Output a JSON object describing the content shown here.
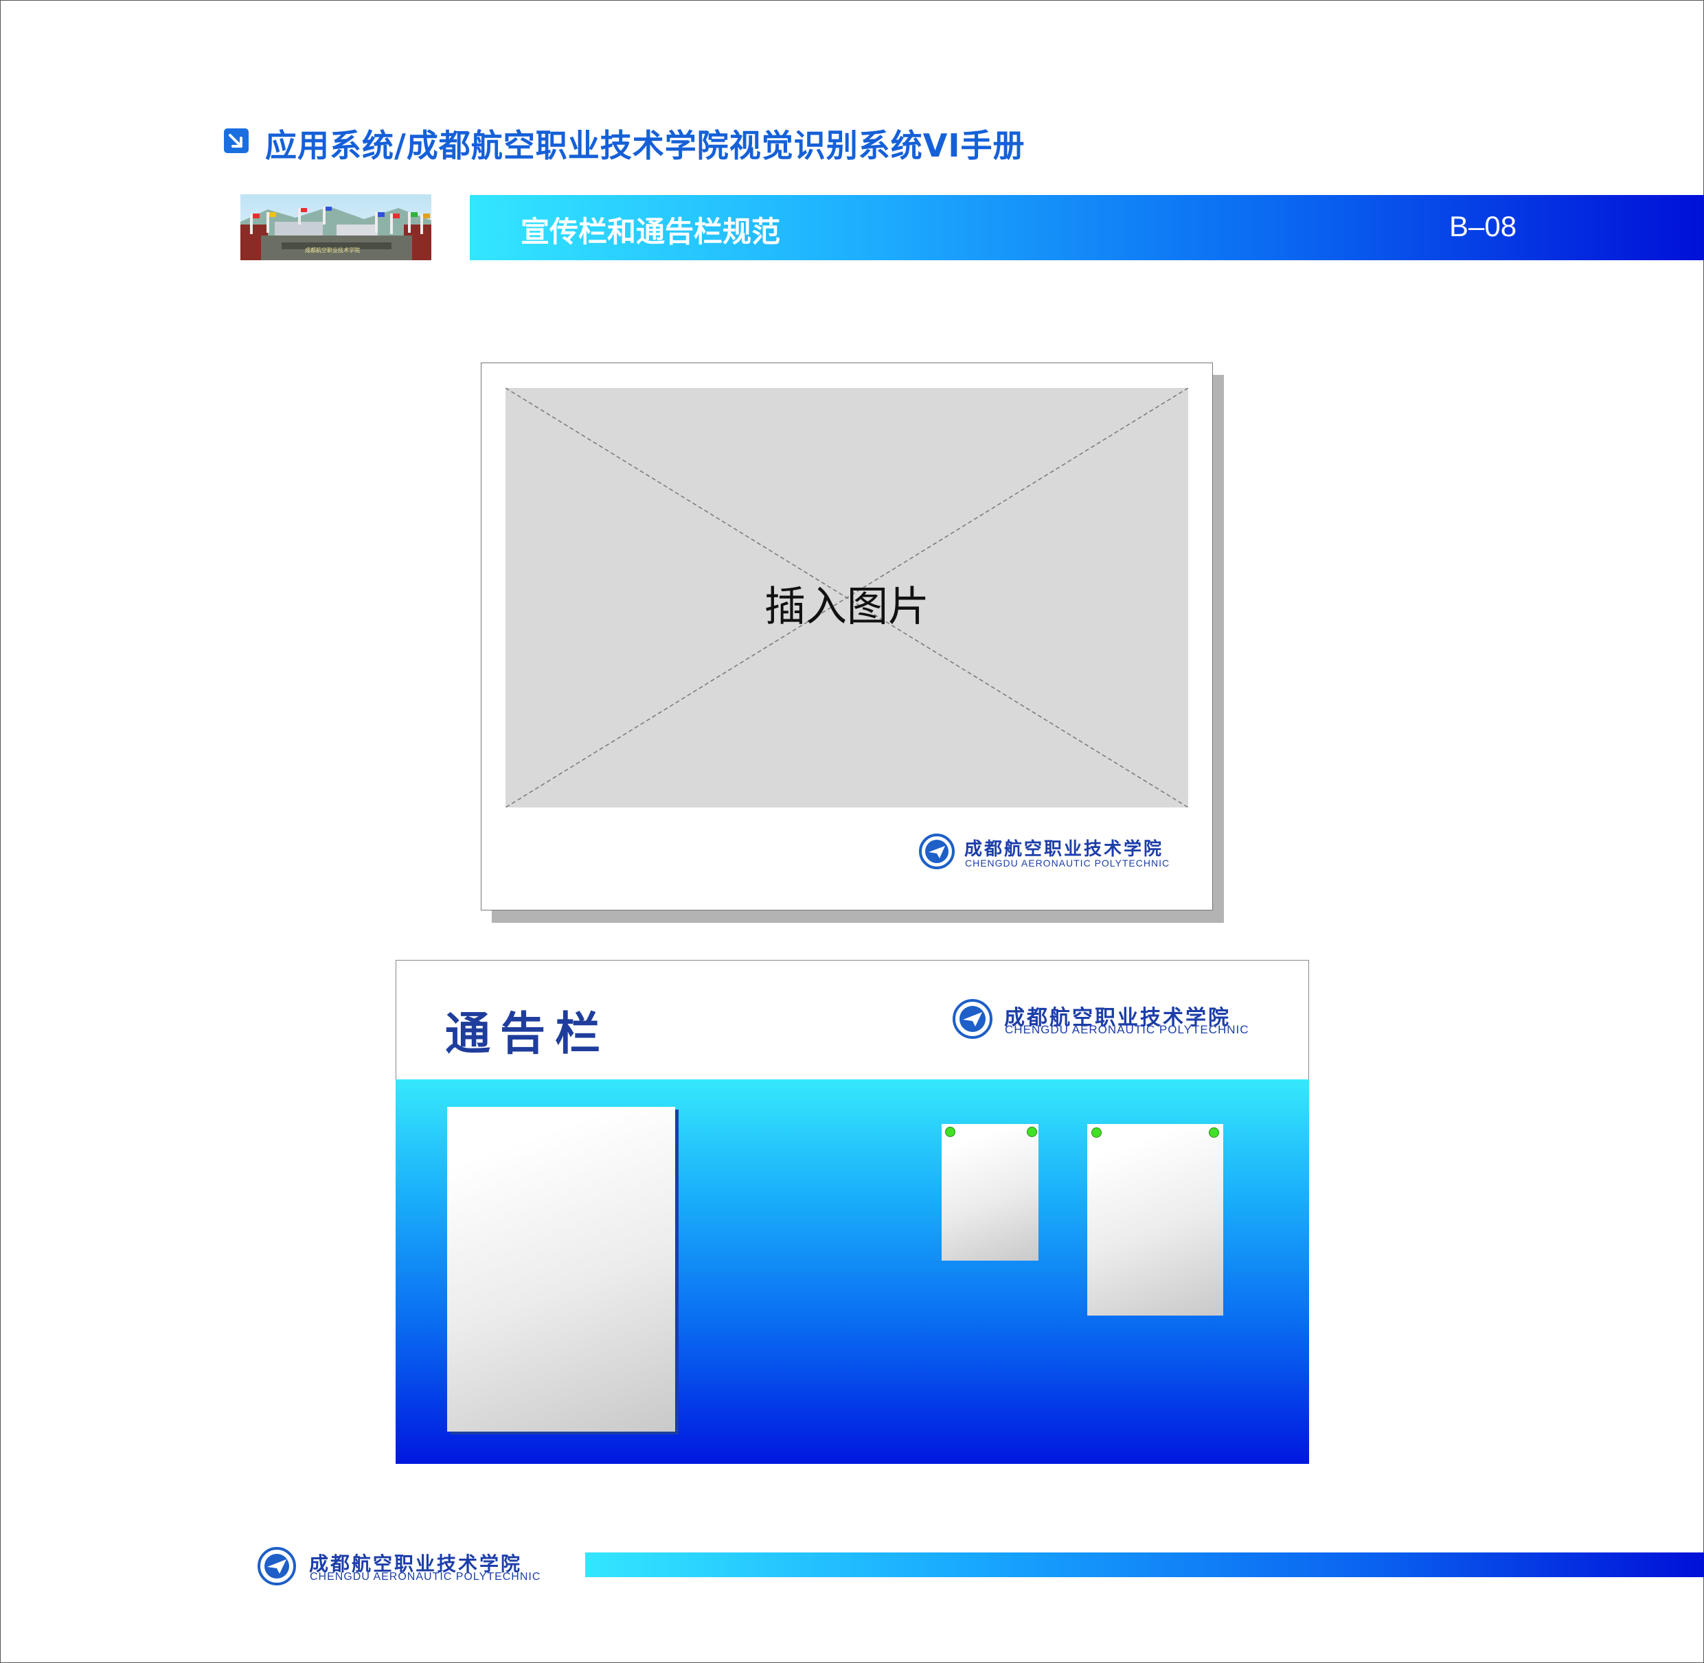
{
  "header": {
    "title": "应用系统/成都航空职业技术学院视觉识别系统VI手册",
    "section_title": "宣传栏和通告栏规范",
    "section_code": "B–08",
    "photo_caption": "成都航空职业技术学院"
  },
  "promo_board": {
    "placeholder_text": "插入图片",
    "logo_cn": "成都航空职业技术学院",
    "logo_en": "CHENGDU AERONAUTIC POLYTECHNIC"
  },
  "notice_board": {
    "title": "通告栏",
    "logo_cn": "成都航空职业技术学院",
    "logo_en": "CHENGDU AERONAUTIC POLYTECHNIC"
  },
  "footer": {
    "logo_cn": "成都航空职业技术学院",
    "logo_en": "CHENGDU AERONAUTIC POLYTECHNIC"
  },
  "colors": {
    "brand_blue": "#1560d8",
    "band_start": "#33e6ff",
    "band_end": "#0010d8",
    "logo_text": "#1c3ea8",
    "pin_green": "#42e026"
  },
  "icons": [
    "arrow-square-icon",
    "college-emblem-icon",
    "paper-plane-icon"
  ]
}
